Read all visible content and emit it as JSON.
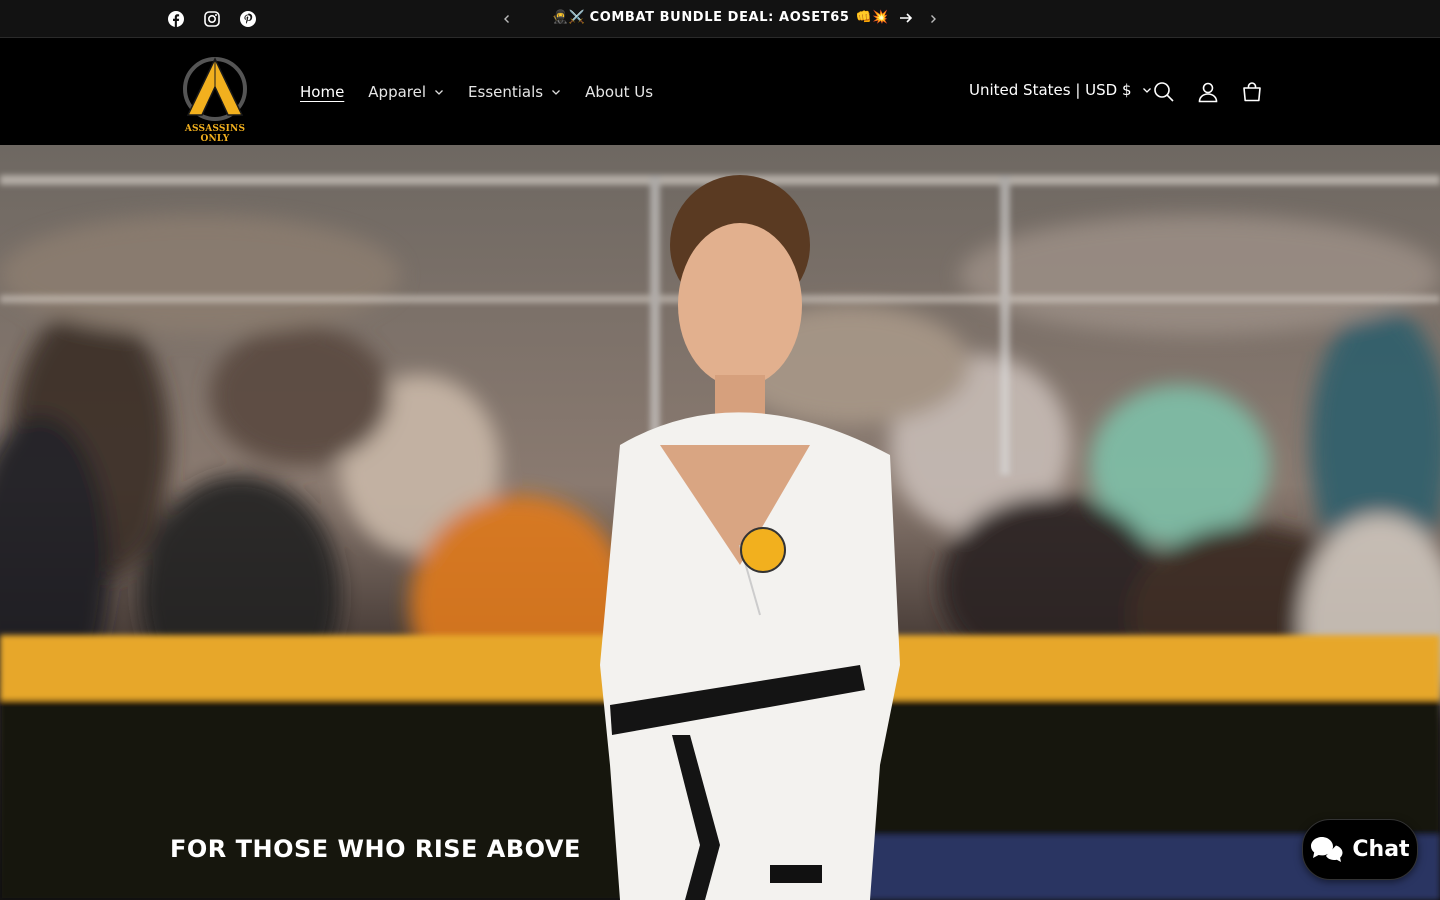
{
  "announcement": {
    "text": "COMBAT BUNDLE DEAL: AOSET65",
    "emoji_before": "🥷⚔️",
    "emoji_after": "👊💥"
  },
  "social": [
    "facebook-icon",
    "instagram-icon",
    "pinterest-icon"
  ],
  "header": {
    "logo_text": "ASSASSINS ONLY",
    "nav": [
      {
        "label": "Home",
        "active": true,
        "dropdown": false
      },
      {
        "label": "Apparel",
        "active": false,
        "dropdown": true
      },
      {
        "label": "Essentials",
        "active": false,
        "dropdown": true
      },
      {
        "label": "About Us",
        "active": false,
        "dropdown": false
      }
    ],
    "currency": "United States | USD $"
  },
  "hero": {
    "title": "FOR THOSE WHO RISE ABOVE"
  },
  "chat": {
    "label": "Chat"
  },
  "colors": {
    "accent": "#f2b01e",
    "background": "#000000"
  }
}
